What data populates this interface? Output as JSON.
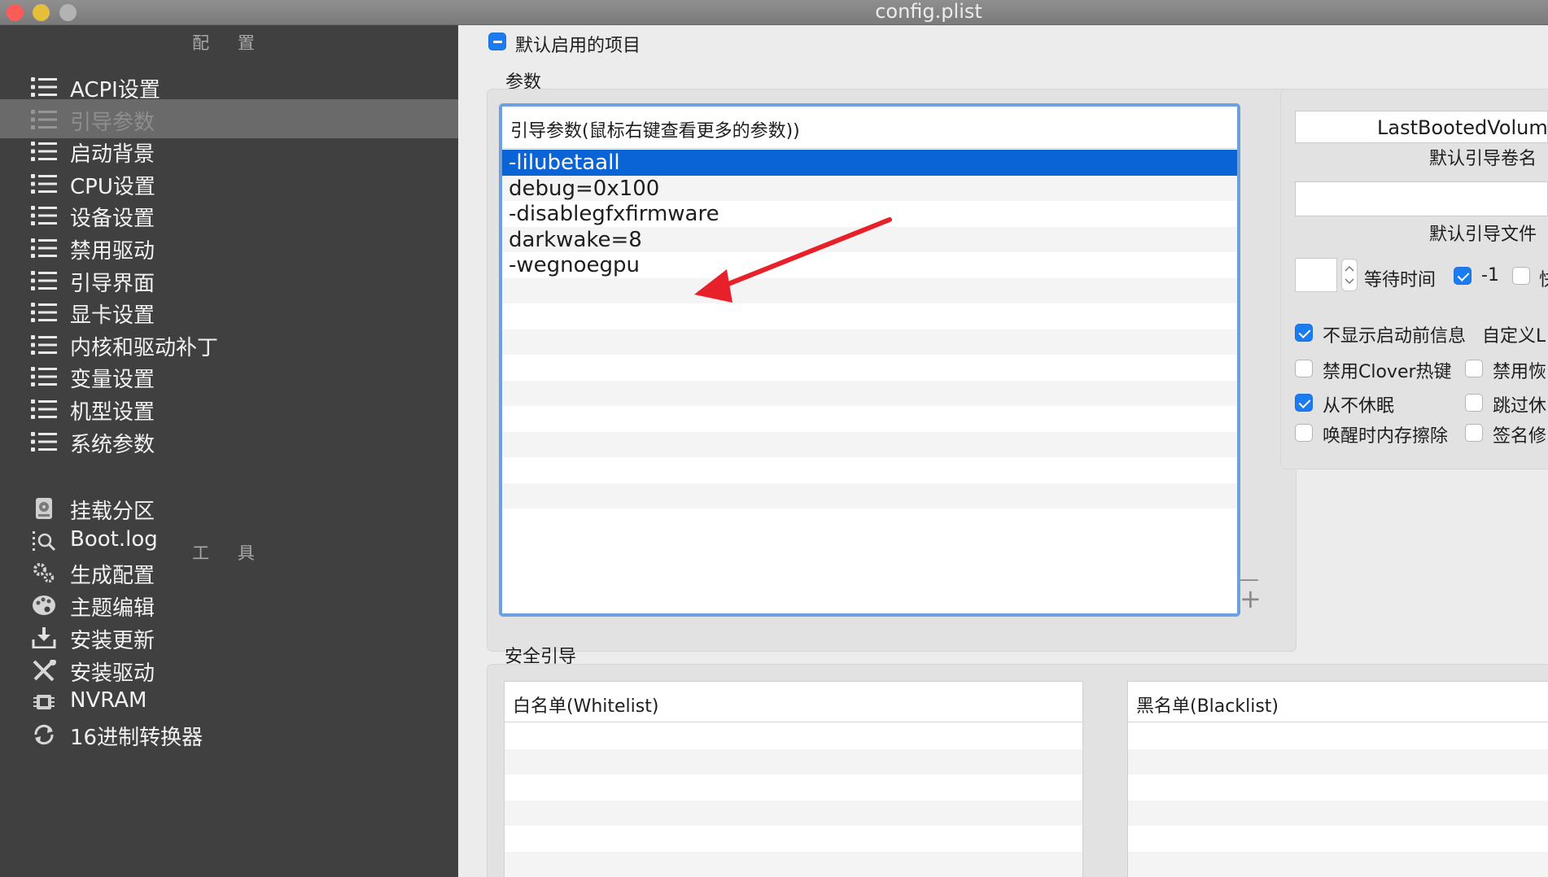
{
  "window": {
    "title": "config.plist"
  },
  "traffic_lights": {
    "close": "#fc5b57",
    "minimize": "#e5bf3c",
    "zoom": "#b3b3b3"
  },
  "sidebar": {
    "config_header": "配 置",
    "config_items": [
      {
        "label": "ACPI设置",
        "icon": "list-icon"
      },
      {
        "label": "引导参数",
        "icon": "list-icon",
        "selected": true
      },
      {
        "label": "启动背景",
        "icon": "list-icon"
      },
      {
        "label": "CPU设置",
        "icon": "list-icon"
      },
      {
        "label": "设备设置",
        "icon": "list-icon"
      },
      {
        "label": "禁用驱动",
        "icon": "list-icon"
      },
      {
        "label": "引导界面",
        "icon": "list-icon"
      },
      {
        "label": "显卡设置",
        "icon": "list-icon"
      },
      {
        "label": "内核和驱动补丁",
        "icon": "list-icon"
      },
      {
        "label": "变量设置",
        "icon": "list-icon"
      },
      {
        "label": "机型设置",
        "icon": "list-icon"
      },
      {
        "label": "系统参数",
        "icon": "list-icon"
      }
    ],
    "tools_header": "工 具",
    "tool_items": [
      {
        "label": "挂载分区",
        "icon": "disk-icon"
      },
      {
        "label": "Boot.log",
        "icon": "log-search-icon"
      },
      {
        "label": "生成配置",
        "icon": "gears-icon"
      },
      {
        "label": "主题编辑",
        "icon": "palette-icon"
      },
      {
        "label": "安装更新",
        "icon": "download-icon"
      },
      {
        "label": "安装驱动",
        "icon": "tools-icon"
      },
      {
        "label": "NVRAM",
        "icon": "chip-icon"
      },
      {
        "label": "16进制转换器",
        "icon": "refresh-icon"
      }
    ]
  },
  "main": {
    "default_enabled_label": "默认启用的项目",
    "params_section_label": "参数",
    "args_table": {
      "header": "引导参数(鼠标右键查看更多的参数))",
      "rows": [
        "-lilubetaall",
        "debug=0x100",
        "-disablegfxfirmware",
        "darkwake=8",
        "-wegnoegpu"
      ],
      "selected_index": 0
    },
    "table_controls": {
      "remove": "—",
      "add": "+"
    },
    "right_panel": {
      "default_volume_value": "LastBootedVolum",
      "default_volume_caption": "默认引导卷名",
      "default_loader_value": "",
      "default_loader_caption": "默认引导文件",
      "timeout_value": "",
      "timeout_label": "等待时间",
      "minus_one_label": "-1",
      "clipped_label_1": "快",
      "checks": [
        {
          "label": "不显示启动前信息",
          "checked": true
        },
        {
          "label": "自定义L",
          "checked": null
        },
        {
          "label": "禁用Clover热键",
          "checked": false
        },
        {
          "label": "禁用恢",
          "checked": false
        },
        {
          "label": "从不休眠",
          "checked": true
        },
        {
          "label": "跳过休",
          "checked": false
        },
        {
          "label": "唤醒时内存擦除",
          "checked": false
        },
        {
          "label": "签名修",
          "checked": false
        }
      ]
    },
    "secure_boot_label": "安全引导",
    "whitelist_header": "白名单(Whitelist)",
    "blacklist_header": "黑名单(Blacklist)"
  },
  "annotation": {
    "arrow_color": "#e8202a"
  }
}
